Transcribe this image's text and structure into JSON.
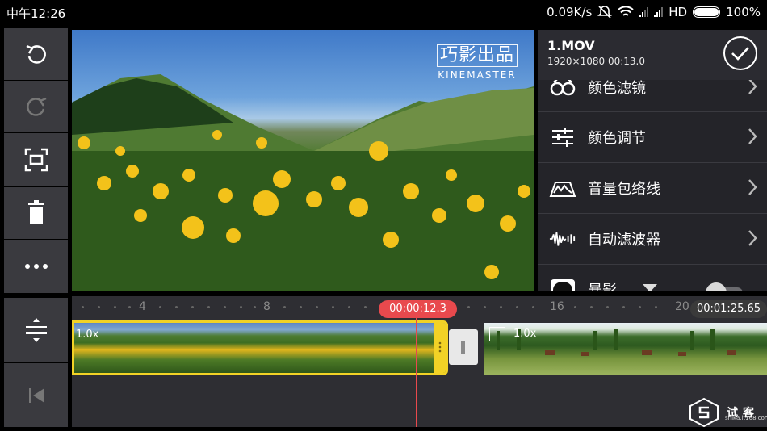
{
  "status_bar": {
    "time": "中午12:26",
    "speed": "0.09K/s",
    "network": "HD",
    "battery": "100%"
  },
  "left_toolbar": {
    "top_icons": [
      "undo-icon",
      "redo-icon",
      "screen-capture-icon",
      "trash-icon",
      "more-icon"
    ],
    "bottom_icons": [
      "track-expand-icon",
      "skip-to-start-icon"
    ]
  },
  "preview": {
    "watermark_line1": "巧影出品",
    "watermark_line2": "KINEMASTER"
  },
  "clip_panel": {
    "clip_name": "1.MOV",
    "clip_info": "1920×1080  00:13.0",
    "items": [
      {
        "label": "颜色滤镜",
        "icon": "color-filter-icon"
      },
      {
        "label": "颜色调节",
        "icon": "color-adjust-icon"
      },
      {
        "label": "音量包络线",
        "icon": "volume-envelope-icon"
      },
      {
        "label": "自动滤波器",
        "icon": "audio-filter-icon"
      },
      {
        "label": "暴影",
        "icon": "vignette-icon"
      }
    ]
  },
  "timeline": {
    "ruler_marks": [
      "4",
      "8",
      "16",
      "20"
    ],
    "playhead_time": "00:00:12.3",
    "total_time": "00:01:25.65",
    "clips": [
      {
        "speed": "1.0x",
        "selected": true
      },
      {
        "speed": "1.0x",
        "selected": false
      }
    ]
  },
  "brand": {
    "name": "试客",
    "site": "shika.it168.com"
  },
  "colors": {
    "accent_red": "#e8494d",
    "selection_yellow": "#f2d226",
    "panel_bg": "#242429",
    "toolbar_bg": "#3a3a3f"
  }
}
